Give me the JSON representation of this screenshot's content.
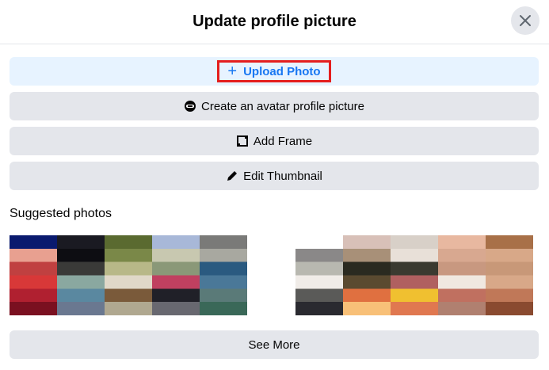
{
  "header": {
    "title": "Update profile picture",
    "close_icon": "close-icon"
  },
  "buttons": {
    "upload": {
      "label": "Upload Photo",
      "icon": "plus-icon",
      "accent": "#1877f2",
      "highlight": "#e41e1e"
    },
    "avatar": {
      "label": "Create an avatar profile picture",
      "icon": "avatar-icon"
    },
    "frame": {
      "label": "Add Frame",
      "icon": "frame-icon"
    },
    "thumbnail": {
      "label": "Edit Thumbnail",
      "icon": "pencil-icon"
    }
  },
  "suggested": {
    "title": "Suggested photos",
    "left_photos": [
      [
        "#0a1a6e",
        "#e8a090",
        "#c04040",
        "#d83838",
        "#b02030",
        "#7a1020"
      ],
      [
        "#1a1a22",
        "#0d0d12",
        "#3a3a38",
        "#8aa8a0",
        "#5a88a0",
        "#6a7890"
      ],
      [
        "#5a6a30",
        "#7a8848",
        "#b8b888",
        "#e0d8c8",
        "#7a5a3a",
        "#b0a890"
      ],
      [
        "#a8b8d8",
        "#c8c8b0",
        "#8a9878",
        "#c04060",
        "#202028",
        "#686870"
      ],
      [
        "#7a7a78",
        "#a8a8a0",
        "#2a5a80",
        "#4a7898",
        "#5a7a78",
        "#3a6858"
      ]
    ],
    "right_photos": [
      [
        "#ffffff",
        "#8a8888",
        "#b8b8b0",
        "#f0ece8",
        "#5a5a58",
        "#2a2a30"
      ],
      [
        "#d8c0b8",
        "#a89078",
        "#2a2a20",
        "#5a4a30",
        "#e07040",
        "#f8c078"
      ],
      [
        "#d8d0c8",
        "#e8e0d8",
        "#3a3a30",
        "#b06060",
        "#f0c030",
        "#e07850"
      ],
      [
        "#e8b8a0",
        "#d8a890",
        "#c89880",
        "#f0e8e0",
        "#c07060",
        "#b08070"
      ],
      [
        "#a87048",
        "#d8a888",
        "#c89878",
        "#d8a888",
        "#c07858",
        "#8a4a30"
      ]
    ]
  },
  "see_more": {
    "label": "See More"
  }
}
